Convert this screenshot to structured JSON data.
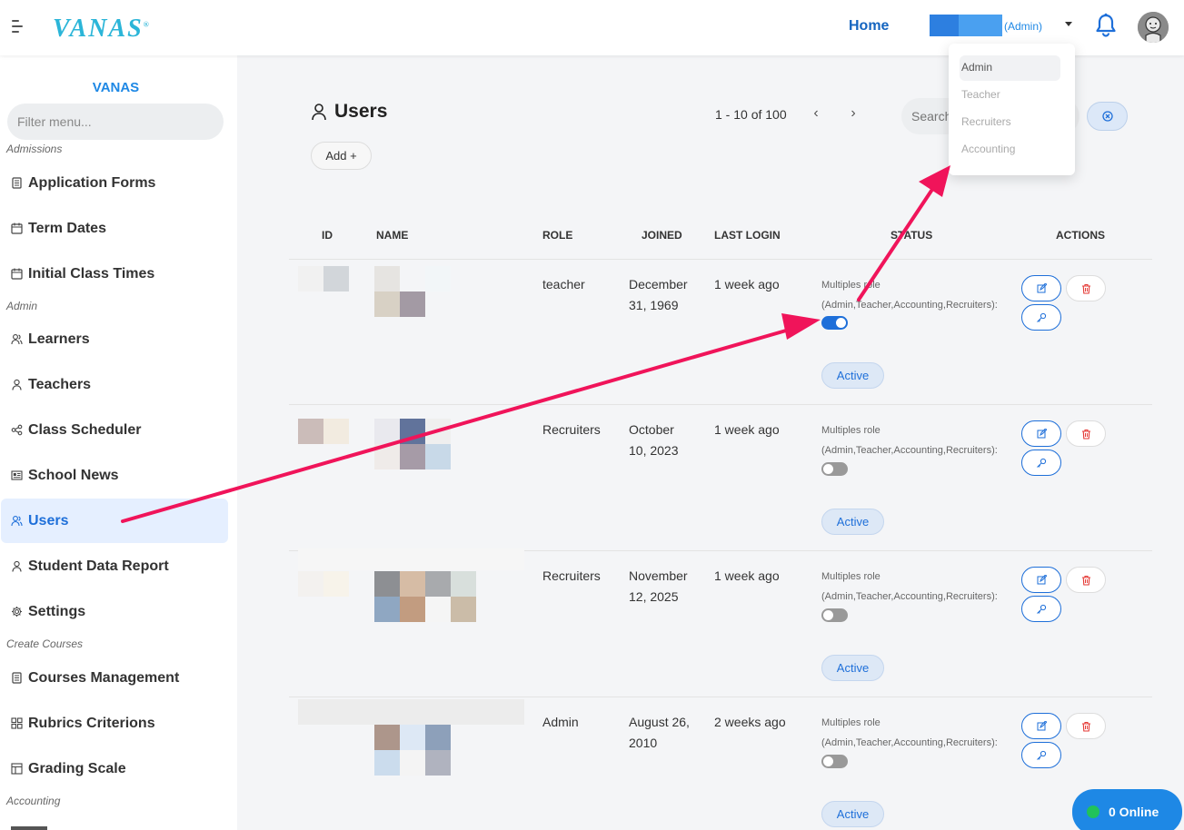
{
  "header": {
    "logo": "VANAS",
    "logo_mark": "®",
    "home_label": "Home",
    "user_role_tag": "(Admin)"
  },
  "role_menu": {
    "items": [
      "Admin",
      "Teacher",
      "Recruiters",
      "Accounting"
    ],
    "selected": "Admin"
  },
  "sidebar": {
    "brand": "VANAS",
    "filter_placeholder": "Filter menu...",
    "sections": {
      "admissions": "Admissions",
      "admin": "Admin",
      "create_courses": "Create Courses",
      "accounting": "Accounting"
    },
    "items": [
      {
        "label": "Application Forms",
        "icon": "form-icon"
      },
      {
        "label": "Term Dates",
        "icon": "calendar-icon"
      },
      {
        "label": "Initial Class Times",
        "icon": "calendar-icon"
      },
      {
        "label": "Learners",
        "icon": "users-icon"
      },
      {
        "label": "Teachers",
        "icon": "user-icon"
      },
      {
        "label": "Class Scheduler",
        "icon": "share-icon"
      },
      {
        "label": "School News",
        "icon": "news-icon"
      },
      {
        "label": "Users",
        "icon": "users-icon",
        "active": true
      },
      {
        "label": "Student Data Report",
        "icon": "user-icon"
      },
      {
        "label": "Settings",
        "icon": "gear-icon"
      },
      {
        "label": "Courses Management",
        "icon": "form-icon"
      },
      {
        "label": "Rubrics Criterions",
        "icon": "grid-icon"
      },
      {
        "label": "Grading Scale",
        "icon": "layout-icon"
      }
    ]
  },
  "page": {
    "title": "Users",
    "pager_text": "1 - 10 of 100",
    "search_placeholder": "Search",
    "add_label": "Add +"
  },
  "table": {
    "headers": [
      "ID",
      "NAME",
      "ROLE",
      "JOINED",
      "LAST LOGIN",
      "STATUS",
      "ACTIONS"
    ],
    "status_label_line1": "Multiples role",
    "status_label_line2": "(Admin,Teacher,Accounting,Recruiters):",
    "rows": [
      {
        "role": "teacher",
        "joined_1": "December",
        "joined_2": "31, 1969",
        "last_login": "1 week ago",
        "multi_role": true,
        "status": "Active"
      },
      {
        "role": "Recruiters",
        "joined_1": "October",
        "joined_2": "10, 2023",
        "last_login": "1 week ago",
        "multi_role": false,
        "status": "Active"
      },
      {
        "role": "Recruiters",
        "joined_1": "November",
        "joined_2": "12, 2025",
        "last_login": "1 week ago",
        "multi_role": false,
        "status": "Active"
      },
      {
        "role": "Admin",
        "joined_1": "August 26,",
        "joined_2": "2010",
        "last_login": "2 weeks ago",
        "multi_role": false,
        "status": "Active"
      }
    ]
  },
  "online": {
    "label": "0 Online",
    "dot_color": "#21c25a"
  },
  "colors": {
    "accent": "#1e88e5",
    "annotation_arrow": "#f0145a"
  }
}
